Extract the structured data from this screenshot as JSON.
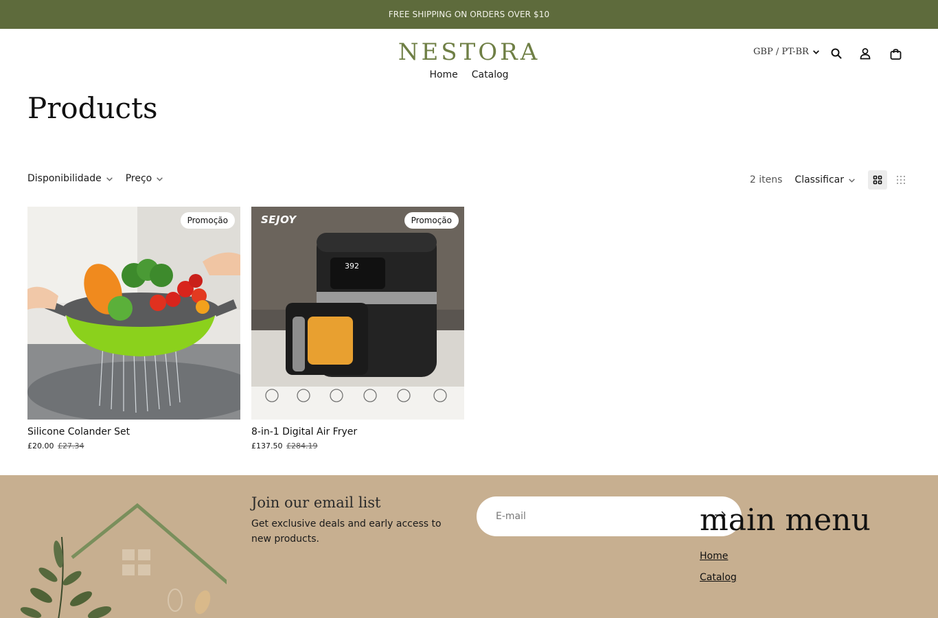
{
  "announcement": "FREE SHIPPING ON ORDERS OVER $10",
  "header": {
    "logo": "NESTORA",
    "nav": [
      "Home",
      "Catalog"
    ],
    "locale": "GBP / PT-BR",
    "icons": [
      "search-icon",
      "account-icon",
      "cart-icon"
    ]
  },
  "page": {
    "title": "Products"
  },
  "filters": {
    "availability": "Disponibilidade",
    "price": "Preço",
    "count": "2 itens",
    "sort": "Classificar"
  },
  "products": [
    {
      "name": "Silicone Colander Set",
      "price": "£20.00",
      "old_price": "£27.34",
      "badge": "Promoção"
    },
    {
      "name": "8-in-1 Digital Air Fryer",
      "price": "£137.50",
      "old_price": "£284.19",
      "badge": "Promoção",
      "brand": "SEJOY",
      "display": "392"
    }
  ],
  "footer": {
    "join_title": "Join our email list",
    "join_text": "Get exclusive deals and early access to new products.",
    "email_placeholder": "E-mail",
    "menu_title": "main menu",
    "menu_links": [
      "Home",
      "Catalog"
    ]
  },
  "colors": {
    "announce_bg": "#5e6b3c",
    "logo": "#6f7f45",
    "footer_bg": "#c7af90"
  }
}
